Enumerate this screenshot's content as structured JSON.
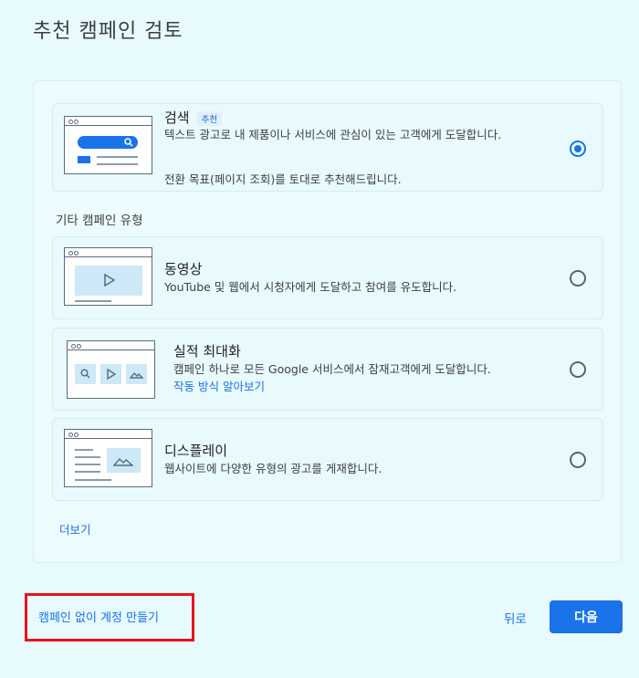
{
  "page_title": "추천 캠페인 검토",
  "recommended": {
    "title": "검색",
    "badge": "추천",
    "description": "텍스트 광고로 내 제품이나 서비스에 관심이 있는 고객에게 도달합니다.",
    "note": "전환 목표(페이지 조회)를 토대로 추천해드립니다.",
    "selected": true
  },
  "other_section_label": "기타 캠페인 유형",
  "campaigns": [
    {
      "title": "동영상",
      "description": "YouTube 및 웹에서 시청자에게 도달하고 참여를 유도합니다.",
      "selected": false
    },
    {
      "title": "실적 최대화",
      "description": "캠페인 하나로 모든 Google 서비스에서 잠재고객에게 도달합니다.",
      "link": "작동 방식 알아보기",
      "selected": false
    },
    {
      "title": "디스플레이",
      "description": "웹사이트에 다양한 유형의 광고를 게재합니다.",
      "selected": false
    }
  ],
  "more_link": "더보기",
  "footer": {
    "skip_link": "캠페인 없이 계정 만들기",
    "back_label": "뒤로",
    "next_label": "다음"
  },
  "colors": {
    "accent": "#1a73e8",
    "highlight": "#e8121e",
    "background": "#e7fafd"
  }
}
